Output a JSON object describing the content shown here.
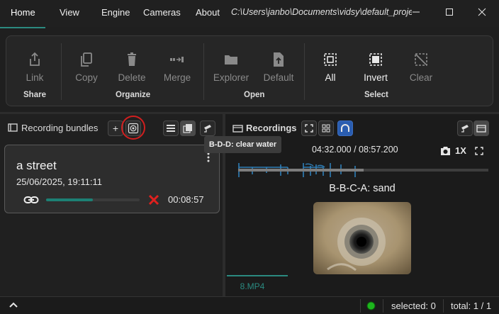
{
  "tabs": {
    "home": "Home",
    "view": "View",
    "engine": "Engine",
    "cameras": "Cameras",
    "about": "About"
  },
  "window": {
    "path": "C:\\Users\\janbo\\Documents\\vidsy\\default_project",
    "minimize_icon": "minimize-icon",
    "maximize_icon": "maximize-icon",
    "close_icon": "close-icon"
  },
  "ribbon": {
    "share": {
      "label": "Share",
      "link": "Link"
    },
    "organize": {
      "label": "Organize",
      "copy": "Copy",
      "delete": "Delete",
      "merge": "Merge"
    },
    "open": {
      "label": "Open",
      "explorer": "Explorer",
      "default": "Default"
    },
    "select": {
      "label": "Select",
      "all": "All",
      "invert": "Invert",
      "clear": "Clear"
    }
  },
  "bundles": {
    "title": "Recording bundles",
    "add": "+",
    "card": {
      "title": "a street",
      "date": "25/06/2025, 19:11:11",
      "duration": "00:08:57",
      "progress": 0.5
    }
  },
  "recordings": {
    "title": "Recordings",
    "tooltip": "B-D-D: clear water",
    "timecode": "04:32.000 / 08:57.200",
    "speed": "1X",
    "playback_progress": 0.5,
    "caption": "B-B-C-A: sand",
    "file_tab": "8.MP4"
  },
  "status": {
    "indicator_color": "#1db51d",
    "selected": "selected: 0",
    "total": "total: 1 / 1"
  },
  "colors": {
    "accent": "#2b8a80",
    "annotation_red": "#d11f1f",
    "delete_red": "#e0201e",
    "active_toggle": "#2a5db0"
  }
}
